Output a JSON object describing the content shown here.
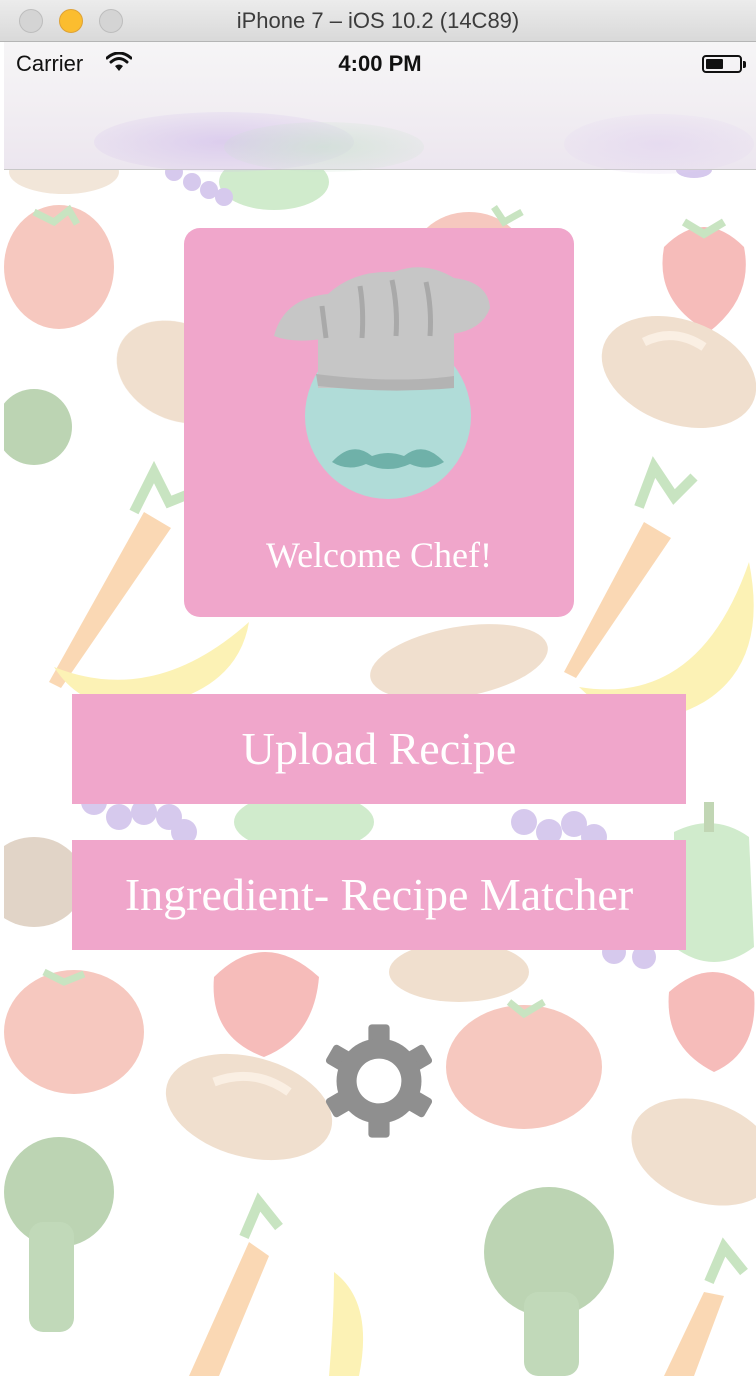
{
  "window": {
    "title": "iPhone 7 – iOS 10.2 (14C89)"
  },
  "status_bar": {
    "carrier": "Carrier",
    "time": "4:00 PM"
  },
  "welcome_card": {
    "text": "Welcome Chef!"
  },
  "buttons": {
    "upload": "Upload Recipe",
    "matcher": "Ingredient- Recipe Matcher"
  },
  "colors": {
    "accent_pink": "#f0a6cb",
    "text_white": "#ffffff",
    "gear_gray": "#8f8f8f",
    "chef_face": "#b0dcd8",
    "mustache": "#6fb1a9",
    "chef_hat": "#c6c6c6"
  },
  "icons": [
    "wifi-icon",
    "battery-icon",
    "chef-logo-icon",
    "gear-icon"
  ]
}
